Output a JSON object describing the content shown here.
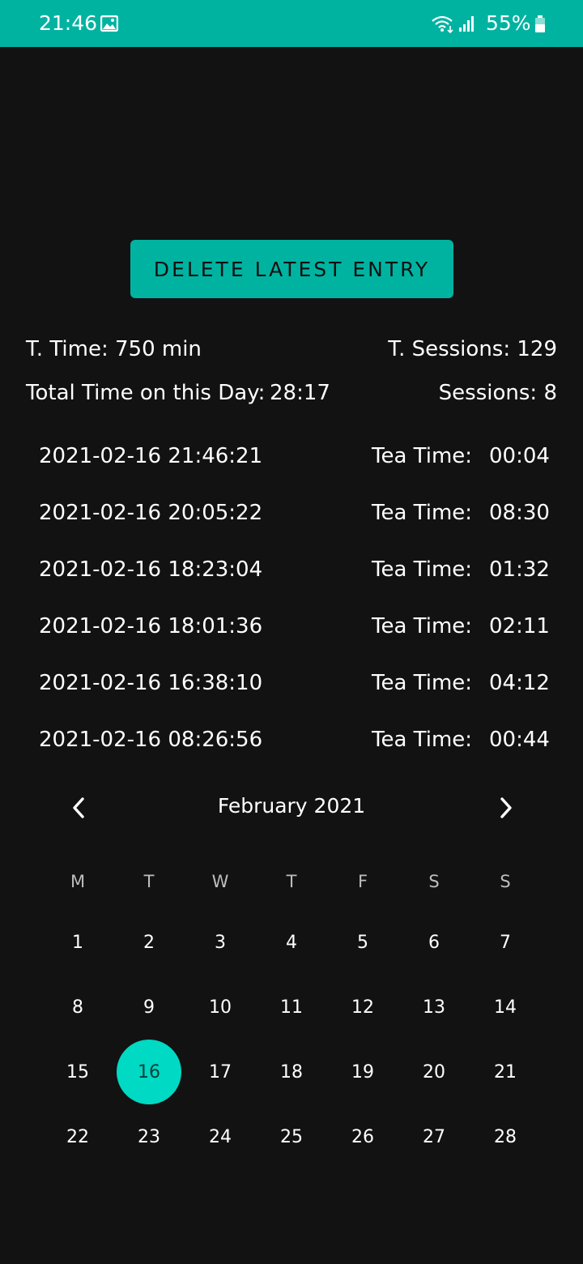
{
  "status_bar": {
    "time": "21:46",
    "battery": "55%",
    "icons": [
      "image-icon",
      "wifi-icon",
      "signal-icon",
      "battery-icon"
    ],
    "background": "#00b3a1"
  },
  "actions": {
    "delete_label": "DELETE LATEST ENTRY",
    "accent": "#00b3a1"
  },
  "stats": {
    "total_time": "T. Time: 750 min",
    "total_sessions": "T. Sessions: 129",
    "day_label": "Total Time on this Day:",
    "day_time": "28:17",
    "day_sessions": "Sessions: 8"
  },
  "entries": [
    {
      "date": "2021-02-16 21:46:21",
      "label": "Tea Time:",
      "duration": "00:04"
    },
    {
      "date": "2021-02-16 20:05:22",
      "label": "Tea Time:",
      "duration": "08:30"
    },
    {
      "date": "2021-02-16 18:23:04",
      "label": "Tea Time:",
      "duration": "01:32"
    },
    {
      "date": "2021-02-16 18:01:36",
      "label": "Tea Time:",
      "duration": "02:11"
    },
    {
      "date": "2021-02-16 16:38:10",
      "label": "Tea Time:",
      "duration": "04:12"
    },
    {
      "date": "2021-02-16 08:26:56",
      "label": "Tea Time:",
      "duration": "00:44"
    }
  ],
  "calendar": {
    "month": "February 2021",
    "weekdays": [
      "M",
      "T",
      "W",
      "T",
      "F",
      "S",
      "S"
    ],
    "weeks": [
      [
        "1",
        "2",
        "3",
        "4",
        "5",
        "6",
        "7"
      ],
      [
        "8",
        "9",
        "10",
        "11",
        "12",
        "13",
        "14"
      ],
      [
        "15",
        "16",
        "17",
        "18",
        "19",
        "20",
        "21"
      ],
      [
        "22",
        "23",
        "24",
        "25",
        "26",
        "27",
        "28"
      ]
    ],
    "selected_day": "16",
    "selected_color": "#00d9c3"
  }
}
